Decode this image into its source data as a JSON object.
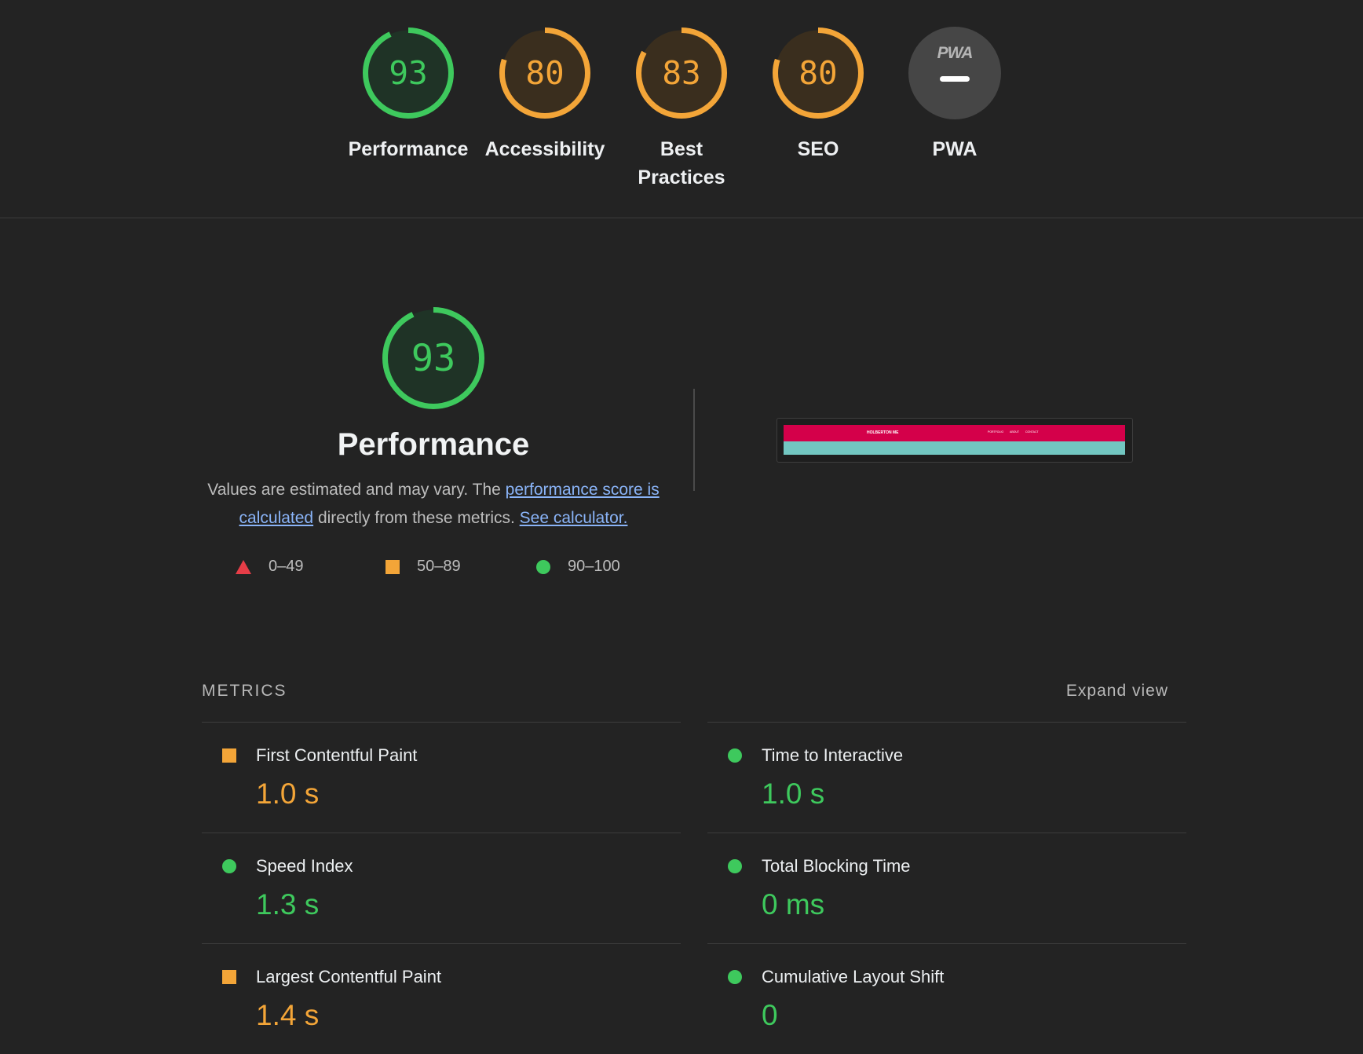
{
  "summary": {
    "gauges": [
      {
        "label": "Performance",
        "score": "93",
        "value": 93,
        "color": "#3ec95d",
        "fill": "#1f3326"
      },
      {
        "label": "Accessibility",
        "score": "80",
        "value": 80,
        "color": "#f3a538",
        "fill": "#3a2e1e"
      },
      {
        "label": "Best Practices",
        "score": "83",
        "value": 83,
        "color": "#f3a538",
        "fill": "#3a2e1e"
      },
      {
        "label": "SEO",
        "score": "80",
        "value": 80,
        "color": "#f3a538",
        "fill": "#3a2e1e"
      }
    ],
    "pwa": {
      "label": "PWA",
      "badge_text": "PWA"
    }
  },
  "performance": {
    "score": "93",
    "value": 93,
    "title": "Performance",
    "desc_pre": "Values are estimated and may vary. The ",
    "desc_link1": "performance score is calculated",
    "desc_mid": " directly from these metrics. ",
    "desc_link2": "See calculator.",
    "legend": [
      {
        "range": "0–49",
        "shape": "triangle",
        "color": "#e63d47"
      },
      {
        "range": "50–89",
        "shape": "square",
        "color": "#f3a538"
      },
      {
        "range": "90–100",
        "shape": "circle",
        "color": "#3ec95d"
      }
    ]
  },
  "screenshot": {
    "brand": "HOLBERTON ME",
    "nav": [
      "PORTFOLIO",
      "ABOUT",
      "CONTACT"
    ]
  },
  "metrics": {
    "heading": "METRICS",
    "expand_label": "Expand view",
    "left": [
      {
        "name": "First Contentful Paint",
        "value": "1.0 s",
        "status": "average"
      },
      {
        "name": "Speed Index",
        "value": "1.3 s",
        "status": "pass"
      },
      {
        "name": "Largest Contentful Paint",
        "value": "1.4 s",
        "status": "average"
      }
    ],
    "right": [
      {
        "name": "Time to Interactive",
        "value": "1.0 s",
        "status": "pass"
      },
      {
        "name": "Total Blocking Time",
        "value": "0 ms",
        "status": "pass"
      },
      {
        "name": "Cumulative Layout Shift",
        "value": "0",
        "status": "pass"
      }
    ]
  }
}
